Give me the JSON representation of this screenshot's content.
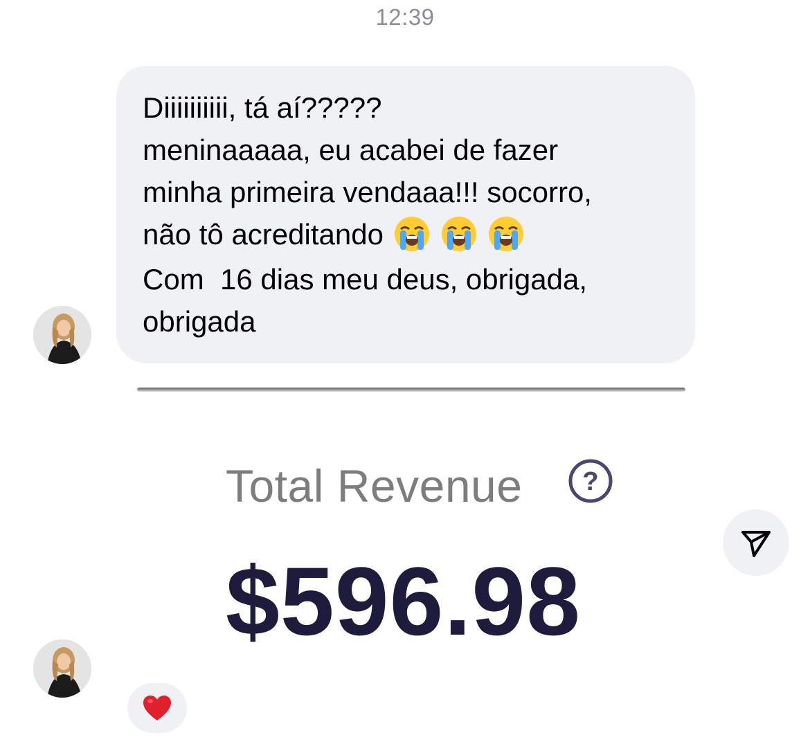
{
  "timestamp": "12:39",
  "message": {
    "lines": [
      "Diiiiiiiiii, tá aí?????",
      "meninaaaaa, eu acabei de fazer",
      "minha primeira vendaaa!!! socorro,",
      "não tô acreditando",
      "Com  16 dias meu deus, obrigada,",
      "obrigada"
    ],
    "emoji_count": 3,
    "emoji_name": "loudly-crying-face"
  },
  "revenue_card": {
    "label": "Total Revenue",
    "value": "$596.98",
    "help_icon": "question-circle-icon"
  },
  "reaction": {
    "emoji": "red-heart-icon"
  },
  "share_icon": "paper-plane-icon",
  "colors": {
    "bubble_bg": "#eff1f5",
    "timestamp": "#8a8d91",
    "revenue_value": "#1e1c3d",
    "revenue_label": "#7d7d7d",
    "heart": "#e0202b"
  }
}
